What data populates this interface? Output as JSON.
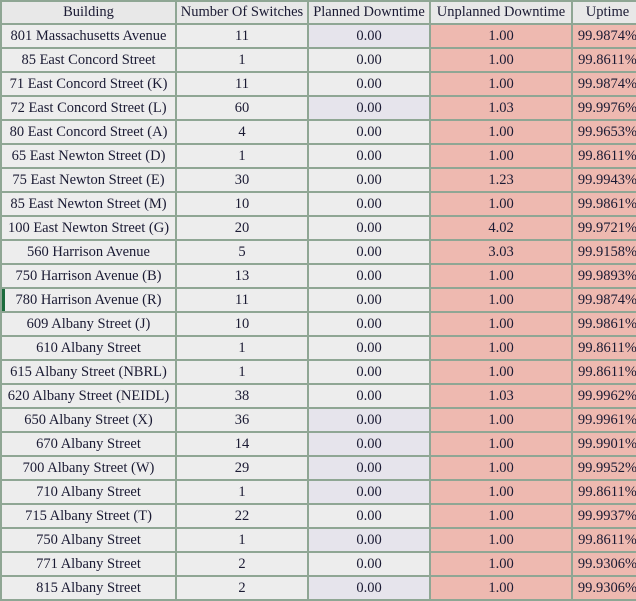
{
  "table": {
    "columns": [
      {
        "key": "building",
        "label": "Building"
      },
      {
        "key": "switches",
        "label": "Number Of Switches"
      },
      {
        "key": "planned",
        "label": "Planned Downtime"
      },
      {
        "key": "unplanned",
        "label": "Unplanned Downtime"
      },
      {
        "key": "uptime",
        "label": "Uptime"
      }
    ],
    "colors": {
      "grid": "#8fa694",
      "header_bg": "#e8e8e8",
      "cell_bg": "#ededed",
      "planned_tint_bg": "#e6e4ec",
      "downtime_bg": "#eeb9b0",
      "selected_marker": "#1c6b3c",
      "text": "#1a1a33"
    },
    "rows": [
      {
        "building": "801 Massachusetts Avenue",
        "switches": "11",
        "planned": "0.00",
        "planned_tint": true,
        "unplanned": "1.00",
        "uptime": "99.9874%",
        "selected": false
      },
      {
        "building": "85 East Concord Street",
        "switches": "1",
        "planned": "0.00",
        "planned_tint": false,
        "unplanned": "1.00",
        "uptime": "99.8611%",
        "selected": false
      },
      {
        "building": "71 East Concord Street (K)",
        "switches": "11",
        "planned": "0.00",
        "planned_tint": false,
        "unplanned": "1.00",
        "uptime": "99.9874%",
        "selected": false
      },
      {
        "building": "72 East Concord Street (L)",
        "switches": "60",
        "planned": "0.00",
        "planned_tint": true,
        "unplanned": "1.03",
        "uptime": "99.9976%",
        "selected": false
      },
      {
        "building": "80 East Concord Street (A)",
        "switches": "4",
        "planned": "0.00",
        "planned_tint": false,
        "unplanned": "1.00",
        "uptime": "99.9653%",
        "selected": false
      },
      {
        "building": "65 East Newton Street (D)",
        "switches": "1",
        "planned": "0.00",
        "planned_tint": false,
        "unplanned": "1.00",
        "uptime": "99.8611%",
        "selected": false
      },
      {
        "building": "75 East Newton Street (E)",
        "switches": "30",
        "planned": "0.00",
        "planned_tint": false,
        "unplanned": "1.23",
        "uptime": "99.9943%",
        "selected": false
      },
      {
        "building": "85 East Newton Street (M)",
        "switches": "10",
        "planned": "0.00",
        "planned_tint": false,
        "unplanned": "1.00",
        "uptime": "99.9861%",
        "selected": false
      },
      {
        "building": "100 East Newton Street (G)",
        "switches": "20",
        "planned": "0.00",
        "planned_tint": false,
        "unplanned": "4.02",
        "uptime": "99.9721%",
        "selected": false
      },
      {
        "building": "560 Harrison Avenue",
        "switches": "5",
        "planned": "0.00",
        "planned_tint": false,
        "unplanned": "3.03",
        "uptime": "99.9158%",
        "selected": false
      },
      {
        "building": "750 Harrison Avenue (B)",
        "switches": "13",
        "planned": "0.00",
        "planned_tint": false,
        "unplanned": "1.00",
        "uptime": "99.9893%",
        "selected": false
      },
      {
        "building": "780 Harrison Avenue (R)",
        "switches": "11",
        "planned": "0.00",
        "planned_tint": false,
        "unplanned": "1.00",
        "uptime": "99.9874%",
        "selected": true
      },
      {
        "building": "609 Albany Street (J)",
        "switches": "10",
        "planned": "0.00",
        "planned_tint": false,
        "unplanned": "1.00",
        "uptime": "99.9861%",
        "selected": false
      },
      {
        "building": "610 Albany Street",
        "switches": "1",
        "planned": "0.00",
        "planned_tint": false,
        "unplanned": "1.00",
        "uptime": "99.8611%",
        "selected": false
      },
      {
        "building": "615 Albany Street (NBRL)",
        "switches": "1",
        "planned": "0.00",
        "planned_tint": false,
        "unplanned": "1.00",
        "uptime": "99.8611%",
        "selected": false
      },
      {
        "building": "620 Albany Street (NEIDL)",
        "switches": "38",
        "planned": "0.00",
        "planned_tint": false,
        "unplanned": "1.03",
        "uptime": "99.9962%",
        "selected": false
      },
      {
        "building": "650 Albany Street (X)",
        "switches": "36",
        "planned": "0.00",
        "planned_tint": true,
        "unplanned": "1.00",
        "uptime": "99.9961%",
        "selected": false
      },
      {
        "building": "670 Albany Street",
        "switches": "14",
        "planned": "0.00",
        "planned_tint": true,
        "unplanned": "1.00",
        "uptime": "99.9901%",
        "selected": false
      },
      {
        "building": "700 Albany Street (W)",
        "switches": "29",
        "planned": "0.00",
        "planned_tint": true,
        "unplanned": "1.00",
        "uptime": "99.9952%",
        "selected": false
      },
      {
        "building": "710 Albany Street",
        "switches": "1",
        "planned": "0.00",
        "planned_tint": true,
        "unplanned": "1.00",
        "uptime": "99.8611%",
        "selected": false
      },
      {
        "building": "715 Albany Street (T)",
        "switches": "22",
        "planned": "0.00",
        "planned_tint": false,
        "unplanned": "1.00",
        "uptime": "99.9937%",
        "selected": false
      },
      {
        "building": "750 Albany Street",
        "switches": "1",
        "planned": "0.00",
        "planned_tint": true,
        "unplanned": "1.00",
        "uptime": "99.8611%",
        "selected": false
      },
      {
        "building": "771 Albany Street",
        "switches": "2",
        "planned": "0.00",
        "planned_tint": false,
        "unplanned": "1.00",
        "uptime": "99.9306%",
        "selected": false
      },
      {
        "building": "815 Albany Street",
        "switches": "2",
        "planned": "0.00",
        "planned_tint": true,
        "unplanned": "1.00",
        "uptime": "99.9306%",
        "selected": false
      }
    ]
  }
}
